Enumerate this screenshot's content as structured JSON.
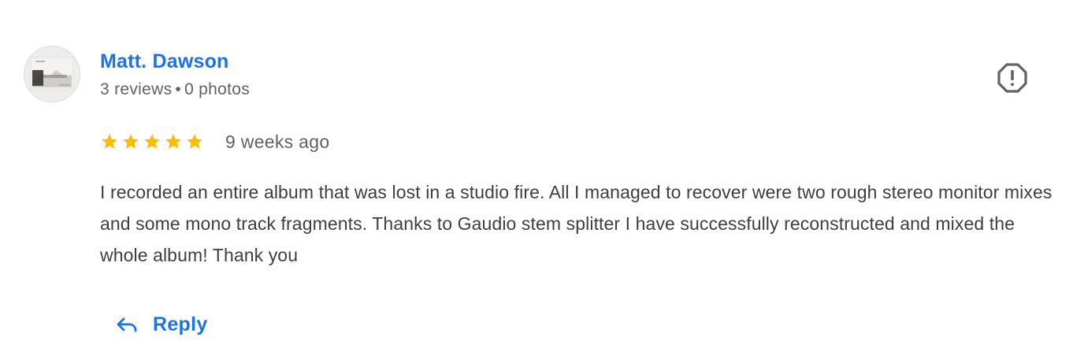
{
  "review": {
    "author": {
      "name": "Matt. Dawson",
      "reviews_count": "3 reviews",
      "separator": "•",
      "photos_count": "0 photos",
      "avatar": "profile-photo"
    },
    "rating": {
      "stars": 5,
      "max_stars": 5,
      "star_color": "#fbbc04",
      "date": "9 weeks ago"
    },
    "text": "I recorded an entire album that was lost in a studio fire. All I managed to recover were two rough stereo monitor mixes and some mono track fragments. Thanks to Gaudio stem splitter I have successfully reconstructed and mixed the whole album! Thank you",
    "actions": {
      "reply_label": "Reply",
      "reply_icon": "reply-arrow-icon",
      "flag_icon": "report-flag-icon"
    }
  },
  "colors": {
    "link_blue": "#1a73e8",
    "secondary_text": "#5f6368",
    "body_text": "#3c4043"
  }
}
